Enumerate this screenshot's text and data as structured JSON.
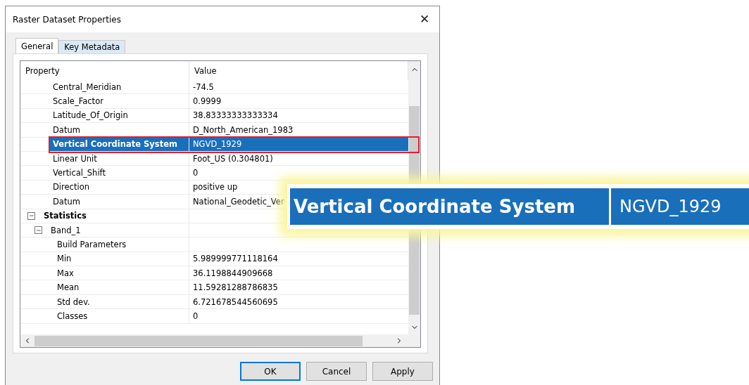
{
  "window": {
    "title": "Raster Dataset Properties",
    "close": "✕"
  },
  "tabs": [
    {
      "label": "General",
      "selected": true
    },
    {
      "label": "Key Metadata",
      "selected": false
    }
  ],
  "table": {
    "columns": [
      "Property",
      "Value"
    ],
    "rows": [
      {
        "label": "Central_Meridian",
        "value": "-74.5",
        "selected": false
      },
      {
        "label": "Scale_Factor",
        "value": "0.9999",
        "selected": false
      },
      {
        "label": "Latitude_Of_Origin",
        "value": "38.83333333333334",
        "selected": false
      },
      {
        "label": "Datum",
        "value": "D_North_American_1983",
        "selected": false
      },
      {
        "label": "Vertical Coordinate System",
        "value": "NGVD_1929",
        "selected": true
      },
      {
        "label": "Linear Unit",
        "value": "Foot_US (0.304801)",
        "selected": false
      },
      {
        "label": "Vertical_Shift",
        "value": "0",
        "selected": false
      },
      {
        "label": "Direction",
        "value": "positive up",
        "selected": false
      },
      {
        "label": "Datum",
        "value": "National_Geodetic_Ver",
        "selected": false
      },
      {
        "label": "Statistics",
        "expanded": true,
        "children": [
          {
            "label": "Band_1",
            "expanded": true,
            "children": [
              {
                "label": "Build Parameters",
                "selected": false
              },
              {
                "label": "Min",
                "value": "5.989999771118164",
                "selected": false
              },
              {
                "label": "Max",
                "value": "36.1198844909668",
                "selected": false
              },
              {
                "label": "Mean",
                "value": "11.59281288786835",
                "selected": false
              },
              {
                "label": "Std dev.",
                "value": "6.721678544560695",
                "selected": false
              },
              {
                "label": "Classes",
                "value": "0",
                "selected": false
              }
            ]
          }
        ]
      }
    ]
  },
  "buttons": [
    {
      "label": "OK",
      "default": true
    },
    {
      "label": "Cancel",
      "default": false
    },
    {
      "label": "Apply",
      "default": false
    }
  ],
  "callout": {
    "property": "Vertical Coordinate System",
    "value": "NGVD_1929"
  }
}
